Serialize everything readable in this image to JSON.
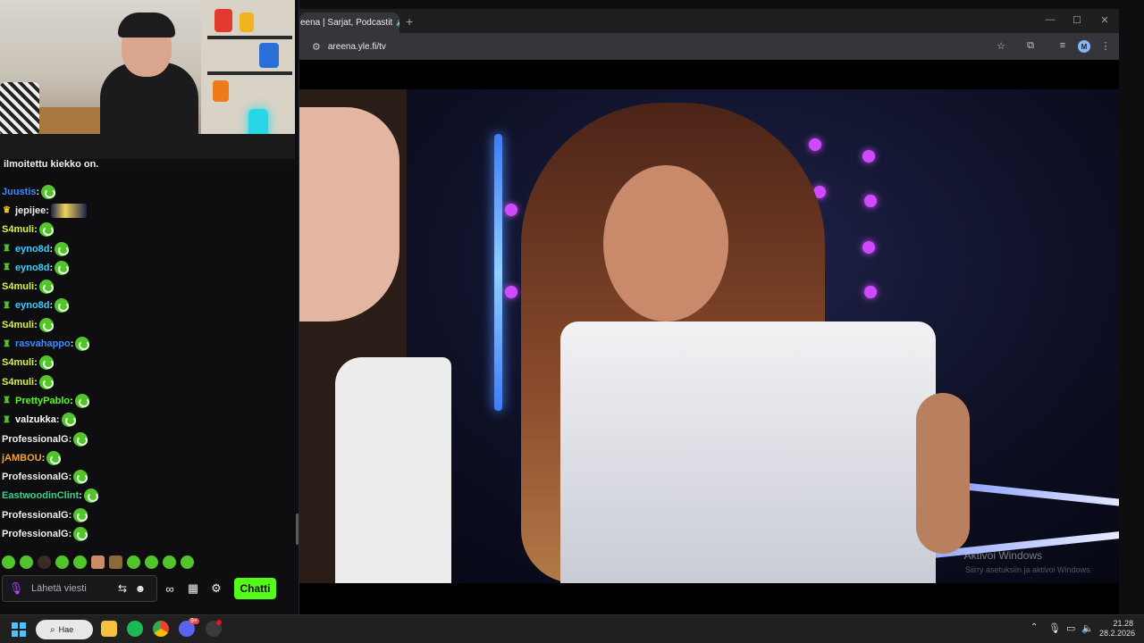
{
  "stream": {
    "pinned_text": "ilmoitettu kiekko on.",
    "chat": [
      {
        "user": "Juustis",
        "color": "#3d8bff",
        "badge": "",
        "emote": "green"
      },
      {
        "user": "jepijee",
        "color": "#efeff1",
        "badge": "crown",
        "emote": "big"
      },
      {
        "user": "S4muli",
        "color": "#d5f34a",
        "badge": "",
        "emote": "green"
      },
      {
        "user": "eyno8d",
        "color": "#3ad0ff",
        "badge": "sub",
        "emote": "green"
      },
      {
        "user": "eyno8d",
        "color": "#3ad0ff",
        "badge": "sub",
        "emote": "green"
      },
      {
        "user": "S4muli",
        "color": "#d5f34a",
        "badge": "",
        "emote": "green"
      },
      {
        "user": "eyno8d",
        "color": "#3ad0ff",
        "badge": "sub",
        "emote": "green"
      },
      {
        "user": "S4muli",
        "color": "#d5f34a",
        "badge": "",
        "emote": "green"
      },
      {
        "user": "rasvahappo",
        "color": "#3d8bff",
        "badge": "sub",
        "emote": "green"
      },
      {
        "user": "S4muli",
        "color": "#d5f34a",
        "badge": "",
        "emote": "green"
      },
      {
        "user": "S4muli",
        "color": "#d5f34a",
        "badge": "",
        "emote": "green"
      },
      {
        "user": "PrettyPablo",
        "color": "#53fc18",
        "badge": "sub",
        "emote": "green"
      },
      {
        "user": "valzukka",
        "color": "#ffffff",
        "badge": "sub",
        "emote": "green"
      },
      {
        "user": "ProfessionalG",
        "color": "#efeff1",
        "badge": "",
        "emote": "green"
      },
      {
        "user": "jAMBOU",
        "color": "#f2a33a",
        "badge": "",
        "emote": "green"
      },
      {
        "user": "ProfessionalG",
        "color": "#efeff1",
        "badge": "",
        "emote": "green"
      },
      {
        "user": "EastwoodinClint",
        "color": "#3ad08a",
        "badge": "",
        "emote": "green"
      },
      {
        "user": "ProfessionalG",
        "color": "#efeff1",
        "badge": "",
        "emote": "green"
      },
      {
        "user": "ProfessionalG",
        "color": "#efeff1",
        "badge": "",
        "emote": "green"
      }
    ],
    "input_placeholder": "Lähetä viesti",
    "chat_button_label": "Chatti",
    "accent": "#53fc18"
  },
  "browser": {
    "tab_title": "eena | Sarjat, Podcastit",
    "tab_close": "✕",
    "new_tab": "+",
    "url": "areena.yle.fi/tv",
    "profile_initial": "M",
    "window_min": "—",
    "window_max": "☐",
    "window_close": "✕"
  },
  "video": {
    "watermark_title": "Aktivoi Windows",
    "watermark_sub": "Siirry asetuksiin ja aktivoi Windows."
  },
  "taskbar": {
    "search_label": "Hae",
    "time": "21.28",
    "date": "28.2.2026",
    "discord_badge": "9+"
  },
  "icons": [
    "start-icon",
    "search-icon",
    "file-explorer-icon",
    "spotify-icon",
    "chrome-icon",
    "discord-icon",
    "obs-icon",
    "mic-icon",
    "bookmark-star-icon",
    "extensions-icon",
    "media-icon",
    "menu-icon"
  ]
}
